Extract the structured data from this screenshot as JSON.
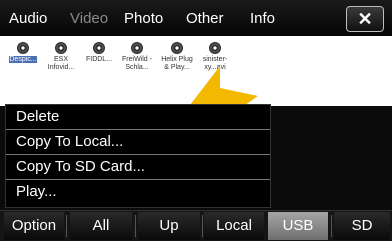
{
  "tabs": [
    "Audio",
    "Video",
    "Photo",
    "Other",
    "Info"
  ],
  "close_label": "✕",
  "files": [
    {
      "name": "Despic..."
    },
    {
      "name": "ESX Infovid..."
    },
    {
      "name": "FIDDL..."
    },
    {
      "name": "FreiWild - Schla..."
    },
    {
      "name": "Helix Plug & Play..."
    },
    {
      "name": "sinister-xy...avi"
    }
  ],
  "menu": [
    "Delete",
    "Copy To Local...",
    "Copy To SD Card...",
    "Play..."
  ],
  "bottom": [
    "Option",
    "All",
    "Up",
    "Local",
    "USB",
    "SD"
  ],
  "colors": {
    "selected_bg": "#4a6fb3",
    "active_button": "#8a8a8a",
    "arrow": "#f3b800"
  }
}
